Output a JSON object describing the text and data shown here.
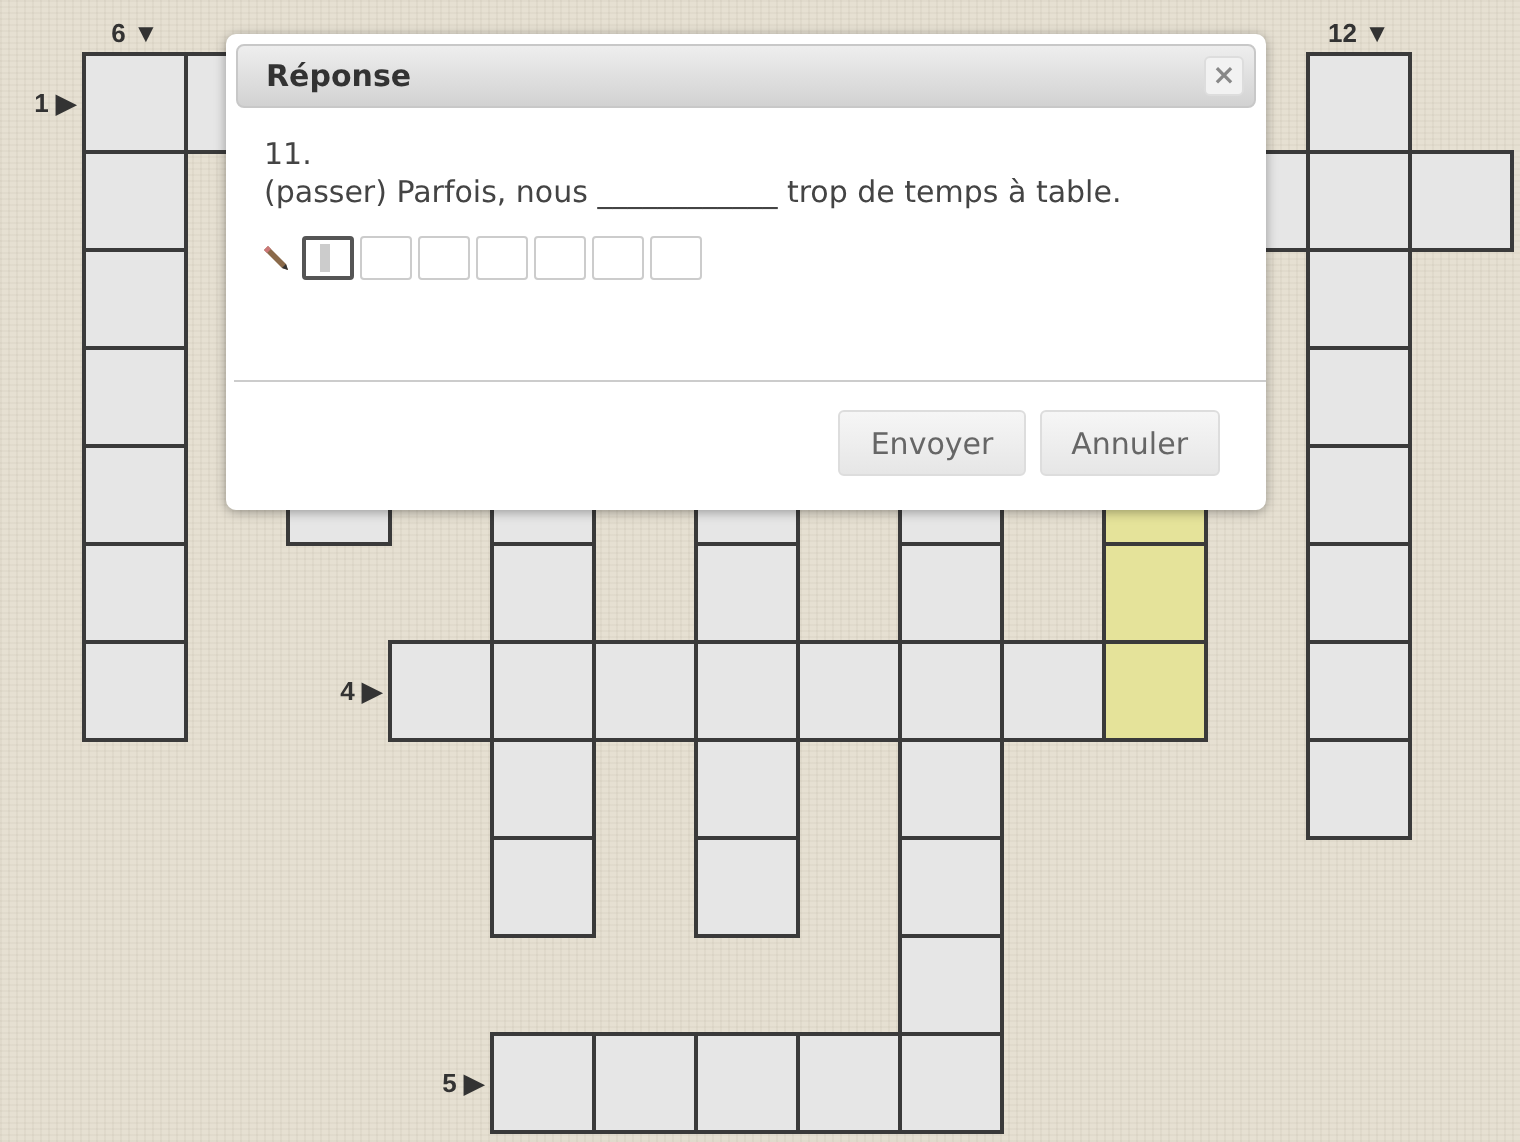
{
  "crossword": {
    "grid": [
      [
        {
          "kind": "gap"
        },
        {
          "kind": "down_label",
          "text": "6 ▼"
        },
        {
          "kind": "gap"
        },
        {
          "kind": "gap"
        },
        {
          "kind": "gap"
        },
        {
          "kind": "gap"
        },
        {
          "kind": "gap"
        },
        {
          "kind": "gap"
        },
        {
          "kind": "gap"
        },
        {
          "kind": "gap"
        },
        {
          "kind": "gap"
        },
        {
          "kind": "gap"
        },
        {
          "kind": "gap"
        },
        {
          "kind": "down_label",
          "text": "12 ▼"
        },
        {
          "kind": "gap"
        }
      ],
      [
        {
          "kind": "across_label",
          "text": "1 ▶"
        },
        {
          "kind": "box"
        },
        {
          "kind": "box"
        },
        {
          "kind": "gap"
        },
        {
          "kind": "gap"
        },
        {
          "kind": "gap"
        },
        {
          "kind": "gap"
        },
        {
          "kind": "gap"
        },
        {
          "kind": "gap"
        },
        {
          "kind": "gap"
        },
        {
          "kind": "gap"
        },
        {
          "kind": "gap"
        },
        {
          "kind": "gap"
        },
        {
          "kind": "box"
        },
        {
          "kind": "gap"
        }
      ],
      [
        {
          "kind": "gap"
        },
        {
          "kind": "box"
        },
        {
          "kind": "gap"
        },
        {
          "kind": "gap"
        },
        {
          "kind": "gap"
        },
        {
          "kind": "gap"
        },
        {
          "kind": "gap"
        },
        {
          "kind": "gap"
        },
        {
          "kind": "gap"
        },
        {
          "kind": "gap"
        },
        {
          "kind": "gap"
        },
        {
          "kind": "gap"
        },
        {
          "kind": "box"
        },
        {
          "kind": "box"
        },
        {
          "kind": "box"
        }
      ],
      [
        {
          "kind": "gap"
        },
        {
          "kind": "box"
        },
        {
          "kind": "gap"
        },
        {
          "kind": "gap"
        },
        {
          "kind": "gap"
        },
        {
          "kind": "gap"
        },
        {
          "kind": "gap"
        },
        {
          "kind": "gap"
        },
        {
          "kind": "gap"
        },
        {
          "kind": "gap"
        },
        {
          "kind": "gap"
        },
        {
          "kind": "gap"
        },
        {
          "kind": "gap"
        },
        {
          "kind": "box"
        },
        {
          "kind": "gap"
        }
      ],
      [
        {
          "kind": "gap"
        },
        {
          "kind": "box"
        },
        {
          "kind": "gap"
        },
        {
          "kind": "gap"
        },
        {
          "kind": "gap"
        },
        {
          "kind": "gap"
        },
        {
          "kind": "gap"
        },
        {
          "kind": "gap"
        },
        {
          "kind": "gap"
        },
        {
          "kind": "gap"
        },
        {
          "kind": "gap"
        },
        {
          "kind": "gap"
        },
        {
          "kind": "gap"
        },
        {
          "kind": "box"
        },
        {
          "kind": "gap"
        }
      ],
      [
        {
          "kind": "gap"
        },
        {
          "kind": "box"
        },
        {
          "kind": "gap"
        },
        {
          "kind": "box"
        },
        {
          "kind": "gap"
        },
        {
          "kind": "box"
        },
        {
          "kind": "gap"
        },
        {
          "kind": "box"
        },
        {
          "kind": "gap"
        },
        {
          "kind": "box"
        },
        {
          "kind": "gap"
        },
        {
          "kind": "active"
        },
        {
          "kind": "gap"
        },
        {
          "kind": "box"
        },
        {
          "kind": "gap"
        }
      ],
      [
        {
          "kind": "gap"
        },
        {
          "kind": "box"
        },
        {
          "kind": "gap"
        },
        {
          "kind": "gap"
        },
        {
          "kind": "gap"
        },
        {
          "kind": "box"
        },
        {
          "kind": "gap"
        },
        {
          "kind": "box"
        },
        {
          "kind": "gap"
        },
        {
          "kind": "box"
        },
        {
          "kind": "gap"
        },
        {
          "kind": "active"
        },
        {
          "kind": "gap"
        },
        {
          "kind": "box"
        },
        {
          "kind": "gap"
        }
      ],
      [
        {
          "kind": "gap"
        },
        {
          "kind": "box"
        },
        {
          "kind": "gap"
        },
        {
          "kind": "across_label",
          "text": "4 ▶"
        },
        {
          "kind": "box"
        },
        {
          "kind": "box"
        },
        {
          "kind": "box"
        },
        {
          "kind": "box"
        },
        {
          "kind": "box"
        },
        {
          "kind": "box"
        },
        {
          "kind": "box"
        },
        {
          "kind": "active"
        },
        {
          "kind": "gap"
        },
        {
          "kind": "box"
        },
        {
          "kind": "gap"
        }
      ],
      [
        {
          "kind": "gap"
        },
        {
          "kind": "gap"
        },
        {
          "kind": "gap"
        },
        {
          "kind": "gap"
        },
        {
          "kind": "gap"
        },
        {
          "kind": "box"
        },
        {
          "kind": "gap"
        },
        {
          "kind": "box"
        },
        {
          "kind": "gap"
        },
        {
          "kind": "box"
        },
        {
          "kind": "gap"
        },
        {
          "kind": "gap"
        },
        {
          "kind": "gap"
        },
        {
          "kind": "box"
        },
        {
          "kind": "gap"
        }
      ],
      [
        {
          "kind": "gap"
        },
        {
          "kind": "gap"
        },
        {
          "kind": "gap"
        },
        {
          "kind": "gap"
        },
        {
          "kind": "gap"
        },
        {
          "kind": "box"
        },
        {
          "kind": "gap"
        },
        {
          "kind": "box"
        },
        {
          "kind": "gap"
        },
        {
          "kind": "box"
        },
        {
          "kind": "gap"
        },
        {
          "kind": "gap"
        },
        {
          "kind": "gap"
        },
        {
          "kind": "gap"
        },
        {
          "kind": "gap"
        }
      ],
      [
        {
          "kind": "gap"
        },
        {
          "kind": "gap"
        },
        {
          "kind": "gap"
        },
        {
          "kind": "gap"
        },
        {
          "kind": "gap"
        },
        {
          "kind": "gap"
        },
        {
          "kind": "gap"
        },
        {
          "kind": "gap"
        },
        {
          "kind": "gap"
        },
        {
          "kind": "box"
        },
        {
          "kind": "gap"
        },
        {
          "kind": "gap"
        },
        {
          "kind": "gap"
        },
        {
          "kind": "gap"
        },
        {
          "kind": "gap"
        }
      ],
      [
        {
          "kind": "gap"
        },
        {
          "kind": "gap"
        },
        {
          "kind": "gap"
        },
        {
          "kind": "gap"
        },
        {
          "kind": "across_label",
          "text": "5 ▶"
        },
        {
          "kind": "box"
        },
        {
          "kind": "box"
        },
        {
          "kind": "box"
        },
        {
          "kind": "box"
        },
        {
          "kind": "box"
        },
        {
          "kind": "gap"
        },
        {
          "kind": "gap"
        },
        {
          "kind": "gap"
        },
        {
          "kind": "gap"
        },
        {
          "kind": "gap"
        }
      ]
    ]
  },
  "dialog": {
    "title": "Réponse",
    "close": "×",
    "clue_number": "11.",
    "clue_text": "(passer) Parfois, nous ____________ trop de temps à table.",
    "letters": [
      {
        "selected": true
      },
      {
        "selected": false
      },
      {
        "selected": false
      },
      {
        "selected": false
      },
      {
        "selected": false
      },
      {
        "selected": false
      },
      {
        "selected": false
      }
    ],
    "buttons": [
      "Envoyer",
      "Annuler"
    ]
  }
}
